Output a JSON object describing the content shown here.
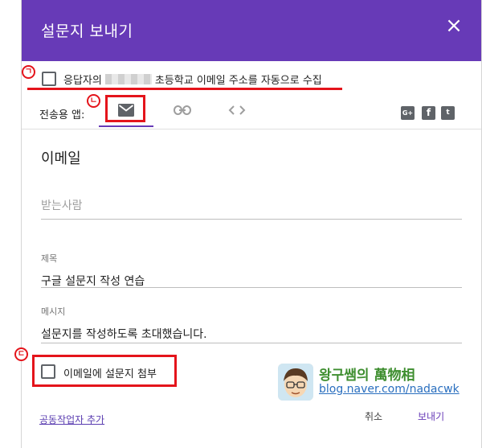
{
  "dialog": {
    "title": "설문지 보내기",
    "close_icon": "close-icon",
    "accent_color": "#673ab7"
  },
  "collect_email": {
    "label_prefix": "응답자의",
    "label_suffix": "초등학교 이메일 주소를 자동으로 수집",
    "checked": false
  },
  "send_via": {
    "label": "전송용 앱:",
    "tabs": [
      {
        "icon": "email-icon",
        "active": true
      },
      {
        "icon": "link-icon",
        "active": false
      },
      {
        "icon": "embed-code-icon",
        "active": false
      }
    ],
    "social": [
      {
        "icon": "google-plus-icon",
        "text": "G+"
      },
      {
        "icon": "facebook-icon",
        "text": "f"
      },
      {
        "icon": "twitter-icon",
        "text": "t"
      }
    ]
  },
  "email_form": {
    "section_title": "이메일",
    "to_placeholder": "받는사람",
    "subject_caption": "제목",
    "subject_value": "구글 설문지 작성 연습",
    "message_caption": "메시지",
    "message_value": "설문지를 작성하도록 초대했습니다.",
    "attach_label": "이메일에 설문지 첨부",
    "attach_checked": false
  },
  "footer": {
    "add_collaborators": "공동작업자 추가",
    "cancel": "취소",
    "send": "보내기"
  },
  "annotations": {
    "marker_1": "ㄱ",
    "marker_2": "ㄴ",
    "marker_3": "ㄷ",
    "highlight_color": "#e4141b"
  },
  "watermark": {
    "title": "왕구쌤의 萬物相",
    "url": "blog.naver.com/nadacwk"
  }
}
